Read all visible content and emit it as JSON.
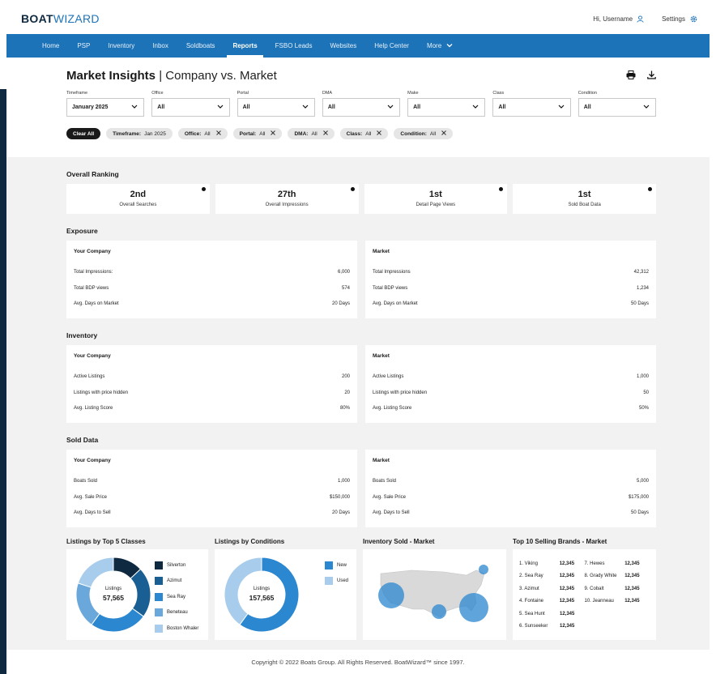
{
  "app": {
    "logo_bold": "BOAT",
    "logo_thin": "WIZARD"
  },
  "topbar": {
    "user": "Hi, Username",
    "settings": "Settings"
  },
  "nav": {
    "items": [
      "Home",
      "PSP",
      "Inventory",
      "Inbox",
      "Soldboats",
      "Reports",
      "FSBO Leads",
      "Websites",
      "Help Center",
      "More"
    ],
    "active": "Reports"
  },
  "page": {
    "title_bold": "Market Insights",
    "title_rest": "Company vs. Market"
  },
  "filters": [
    {
      "label": "Timeframe",
      "value": "January 2025"
    },
    {
      "label": "Office",
      "value": "All"
    },
    {
      "label": "Portal",
      "value": "All"
    },
    {
      "label": "DMA",
      "value": "All"
    },
    {
      "label": "Make",
      "value": "All"
    },
    {
      "label": "Class",
      "value": "All"
    },
    {
      "label": "Condition",
      "value": "All"
    }
  ],
  "chips": {
    "clear": "Clear All",
    "items": [
      {
        "key": "Timeframe:",
        "val": "Jan 2025",
        "closable": false
      },
      {
        "key": "Office:",
        "val": "All",
        "closable": true
      },
      {
        "key": "Portal:",
        "val": "All",
        "closable": true
      },
      {
        "key": "DMA:",
        "val": "All",
        "closable": true
      },
      {
        "key": "Class:",
        "val": "All",
        "closable": true
      },
      {
        "key": "Condition:",
        "val": "All",
        "closable": true
      }
    ]
  },
  "ranking": {
    "title": "Overall Ranking",
    "cards": [
      {
        "value": "2nd",
        "label": "Overall Searches"
      },
      {
        "value": "27th",
        "label": "Overall Impressions"
      },
      {
        "value": "1st",
        "label": "Detail Page Views"
      },
      {
        "value": "1st",
        "label": "Sold Boat Data"
      }
    ]
  },
  "exposure": {
    "title": "Exposure",
    "company": {
      "title": "Your Company",
      "rows": [
        [
          "Total Impressions:",
          "6,000"
        ],
        [
          "Total BDP views",
          "574"
        ],
        [
          "Avg. Days on Market",
          "20 Days"
        ]
      ]
    },
    "market": {
      "title": "Market",
      "rows": [
        [
          "Total Impressions",
          "42,312"
        ],
        [
          "Total BDP views",
          "1,234"
        ],
        [
          "Avg. Days on Market",
          "50 Days"
        ]
      ]
    }
  },
  "inventory": {
    "title": "Inventory",
    "company": {
      "title": "Your Company",
      "rows": [
        [
          "Active Listings",
          "200"
        ],
        [
          "Listings with price hidden",
          "20"
        ],
        [
          "Avg. Listing Score",
          "80%"
        ]
      ]
    },
    "market": {
      "title": "Market",
      "rows": [
        [
          "Active Listings",
          "1,000"
        ],
        [
          "Listings with price hidden",
          "50"
        ],
        [
          "Avg. Listing Score",
          "50%"
        ]
      ]
    }
  },
  "sold": {
    "title": "Sold Data",
    "company": {
      "title": "Your Company",
      "rows": [
        [
          "Boats Sold",
          "1,000"
        ],
        [
          "Avg. Sale Price",
          "$150,000"
        ],
        [
          "Avg. Days to Sell",
          "20 Days"
        ]
      ]
    },
    "market": {
      "title": "Market",
      "rows": [
        [
          "Boats Sold",
          "5,000"
        ],
        [
          "Avg. Sale Price",
          "$175,000"
        ],
        [
          "Avg. Days to Sell",
          "50 Days"
        ]
      ]
    }
  },
  "charts": {
    "classes": {
      "title": "Listings by Top 5 Classes",
      "center_label": "Listings",
      "center_value": "57,565",
      "legend": [
        {
          "name": "Silverton",
          "color": "#0f2a40"
        },
        {
          "name": "Azimut",
          "color": "#1a5f93"
        },
        {
          "name": "Sea Ray",
          "color": "#2a87d0"
        },
        {
          "name": "Beneteau",
          "color": "#6aa8dc"
        },
        {
          "name": "Boston Whaler",
          "color": "#a8cceb"
        }
      ]
    },
    "conditions": {
      "title": "Listings by Conditions",
      "center_label": "Listings",
      "center_value": "157,565",
      "legend": [
        {
          "name": "New",
          "color": "#2a87d0"
        },
        {
          "name": "Used",
          "color": "#a8cceb"
        }
      ]
    },
    "map": {
      "title": "Inventory Sold - Market"
    },
    "brands": {
      "title": "Top 10 Selling Brands  - Market",
      "rows": [
        [
          {
            "n": "1. Viking",
            "v": "12,345"
          },
          {
            "n": "7. Hewes",
            "v": "12,345"
          }
        ],
        [
          {
            "n": "2. Sea Ray",
            "v": "12,345"
          },
          {
            "n": "8. Grady White",
            "v": "12,345"
          }
        ],
        [
          {
            "n": "3. Azimut",
            "v": "12,345"
          },
          {
            "n": "9. Cobalt",
            "v": "12,345"
          }
        ],
        [
          {
            "n": "4. Fontaine",
            "v": "12,345"
          },
          {
            "n": "10. Jeanneau",
            "v": "12,345"
          }
        ],
        [
          {
            "n": "5. Sea Hunt",
            "v": "12,345"
          },
          null
        ],
        [
          {
            "n": "6. Sunseeker",
            "v": "12,345"
          },
          null
        ]
      ]
    }
  },
  "chart_data": [
    {
      "type": "pie",
      "title": "Listings by Top 5 Classes",
      "categories": [
        "Silverton",
        "Azimut",
        "Sea Ray",
        "Beneteau",
        "Boston Whaler"
      ],
      "values": [
        0.13,
        0.22,
        0.25,
        0.2,
        0.2
      ]
    },
    {
      "type": "pie",
      "title": "Listings by Conditions",
      "categories": [
        "New",
        "Used"
      ],
      "values": [
        0.6,
        0.4
      ]
    }
  ],
  "footer": {
    "text": "Copyright © 2022 Boats Group. All Rights Reserved. BoatWizard™ since 1997."
  }
}
